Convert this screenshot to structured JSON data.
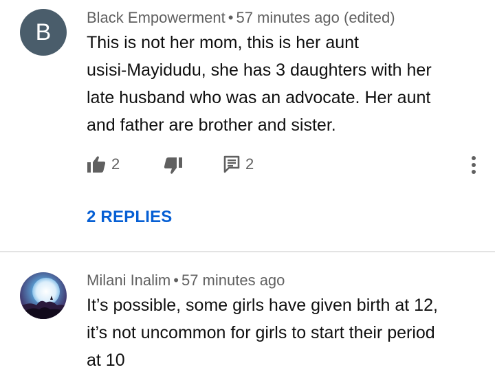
{
  "comments": [
    {
      "avatar_letter": "B",
      "author": "Black Empowerment",
      "separator": "•",
      "time": "57 minutes ago (edited)",
      "lines": [
        "This is not her mom, this is her aunt",
        "usisi-Mayidudu, she has 3 daughters with her",
        "late husband who was an advocate. Her aunt",
        "and father are brother and sister."
      ],
      "likes": "2",
      "reply_count": "2",
      "replies_link": "2 REPLIES"
    },
    {
      "author": "Milani Inalim",
      "separator": "•",
      "time": "57 minutes ago",
      "lines": [
        "It’s possible, some girls have given birth at 12,",
        "it’s not uncommon for girls to start their period",
        "at 10"
      ]
    }
  ],
  "colors": {
    "link": "#065fd4",
    "meta": "#606060",
    "avatar_bg": "#4a5d6b"
  },
  "icons": [
    "like-icon",
    "dislike-icon",
    "reply-icon",
    "more-icon"
  ]
}
